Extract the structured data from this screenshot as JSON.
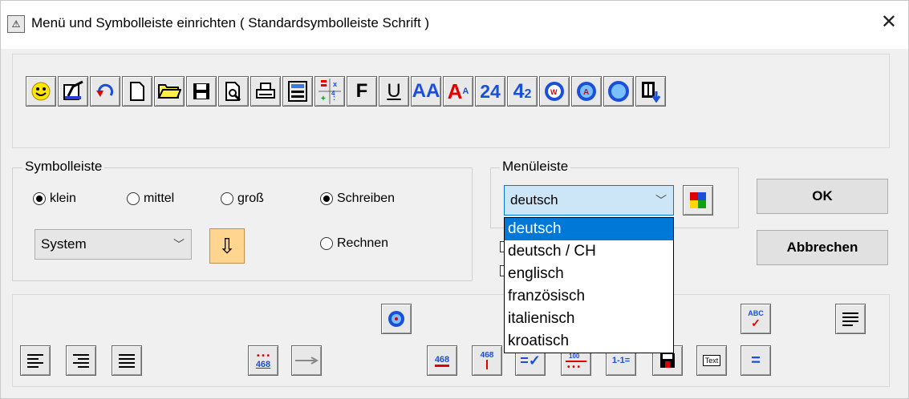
{
  "window": {
    "title": "Menü und Symbolleiste einrichten  ( Standardsymbolleiste Schrift )",
    "close": "✕"
  },
  "toolbar": {
    "icons": [
      "smiley-icon",
      "edit-document-icon",
      "undo-icon",
      "new-file-icon",
      "open-folder-icon",
      "save-icon",
      "print-preview-icon",
      "print-icon",
      "calculator-icon",
      "math-grid-icon",
      "bold-f-icon",
      "underline-u-icon",
      "font-aa-icon",
      "font-size-icon",
      "numbers-24-icon",
      "numbers-42-icon",
      "circle-w-icon",
      "circle-a-icon",
      "circle-icon",
      "book-exit-icon"
    ],
    "bold_label": "F",
    "underline_label": "U",
    "aa_label": "AA",
    "asize_label": "A",
    "asize_sup": "A",
    "n24": "24",
    "n42_big": "4",
    "n42_small": "2"
  },
  "symbolleiste": {
    "label": "Symbolleiste",
    "sizes": [
      {
        "label": "klein",
        "checked": true
      },
      {
        "label": "mittel",
        "checked": false
      },
      {
        "label": "groß",
        "checked": false
      }
    ],
    "mode_write": {
      "label": "Schreiben",
      "checked": true
    },
    "mode_calc": {
      "label": "Rechnen",
      "checked": false
    },
    "system_select": "System",
    "chevron": "﹀",
    "arrow": "⇩"
  },
  "menueleiste": {
    "label": "Menüleiste",
    "selected": "deutsch",
    "options": [
      "deutsch",
      "deutsch / CH",
      "englisch",
      "französisch",
      "italienisch",
      "kroatisch"
    ]
  },
  "buttons": {
    "ok": "OK",
    "cancel": "Abbrechen"
  },
  "bottom": {
    "n468": "468",
    "check_eq": "=✓",
    "one_eq": "1-1=",
    "abc": "ABC",
    "text_label": "Text",
    "equals": "="
  },
  "colors": {
    "accent": "#0078d7",
    "orange_button": "#ffd58f",
    "blue_icon": "#1a4fd8",
    "red_icon": "#e00000"
  }
}
